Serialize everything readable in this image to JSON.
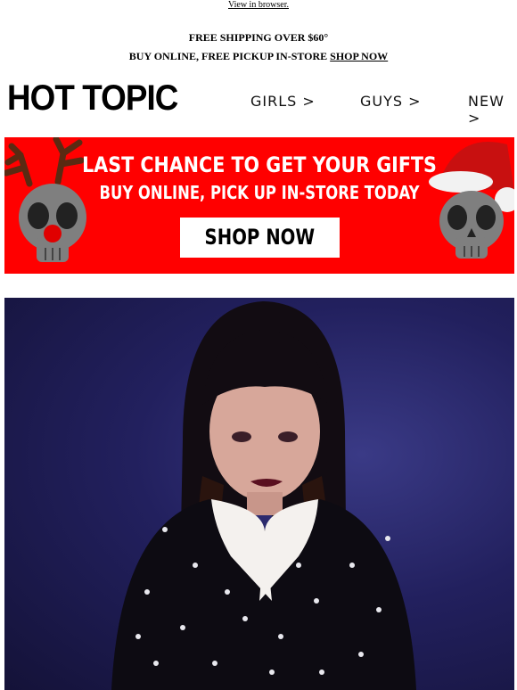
{
  "header": {
    "view_in_browser": "View in browser.",
    "shipping_line": "FREE SHIPPING OVER $60°",
    "pickup_prefix": "BUY ONLINE, FREE PICKUP IN-STORE ",
    "pickup_link": "SHOP NOW"
  },
  "brand": {
    "logo": "HOT TOPIC"
  },
  "nav": {
    "girls": "GIRLS >",
    "guys": "GUYS >",
    "new": "NEW >"
  },
  "promo": {
    "line1": "LAST CHANCE TO GET YOUR GIFTS",
    "line2": "BUY ONLINE, PICK UP IN-STORE TODAY",
    "button": "SHOP NOW",
    "colors": {
      "background": "#ff0000",
      "text": "#ffffff"
    },
    "decorations": [
      "reindeer-skull-icon",
      "santa-hat-skull-icon"
    ]
  },
  "hero": {
    "description_icon": "model-photo"
  }
}
